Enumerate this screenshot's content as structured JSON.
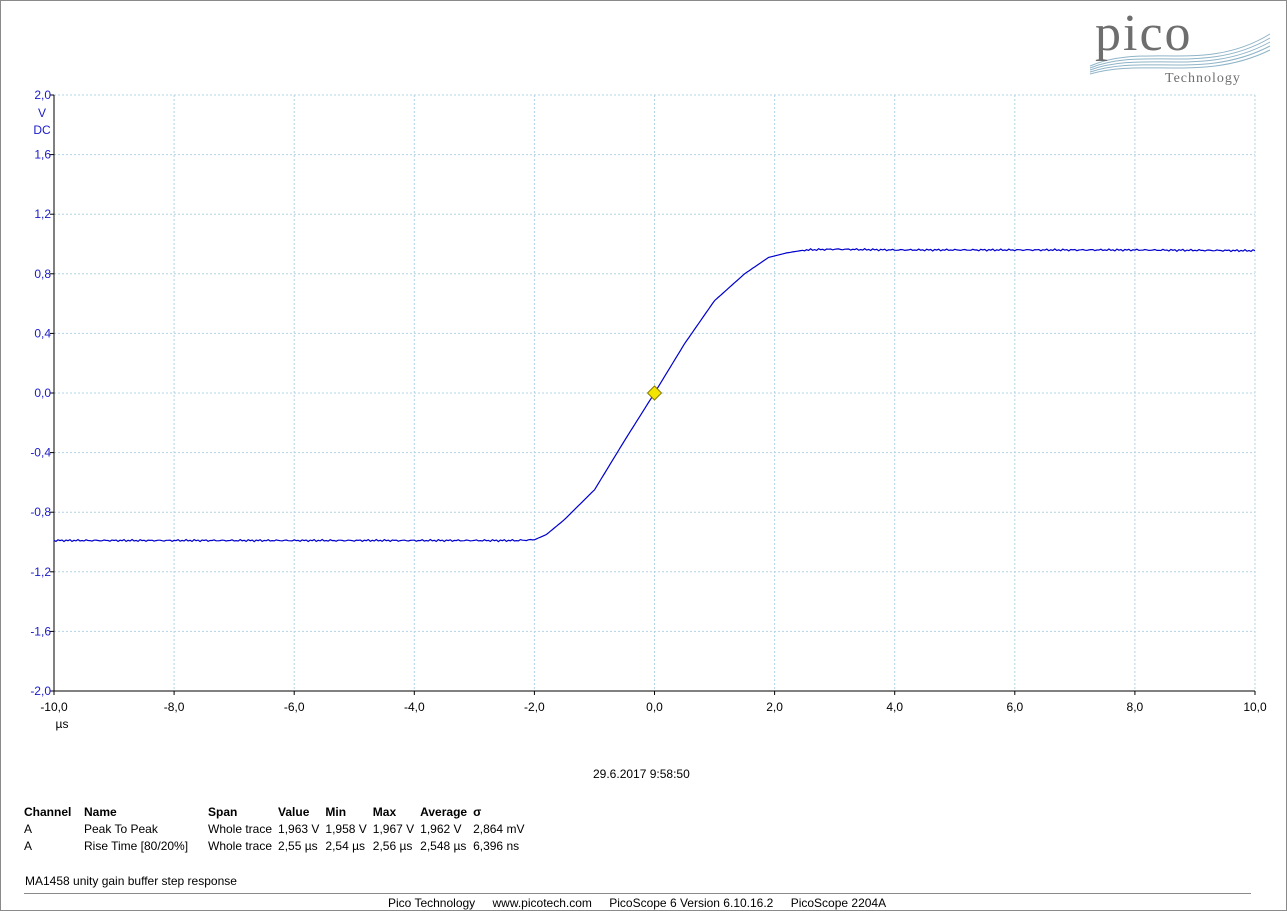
{
  "logo": {
    "name": "pico",
    "sub": "Technology"
  },
  "chart_data": {
    "type": "line",
    "title": "",
    "xlabel": "µs",
    "ylabel_lines": [
      "V",
      "DC"
    ],
    "xlim": [
      -10,
      10
    ],
    "ylim": [
      -2,
      2
    ],
    "grid": true,
    "x_ticks": [
      "-10,0",
      "-8,0",
      "-6,0",
      "-4,0",
      "-2,0",
      "0,0",
      "2,0",
      "4,0",
      "6,0",
      "8,0",
      "10,0"
    ],
    "y_ticks": [
      "2,0",
      "1,6",
      "1,2",
      "0,8",
      "0,4",
      "0,0",
      "-0,4",
      "-0,8",
      "-1,2",
      "-1,6",
      "-2,0"
    ],
    "series": [
      {
        "color": "#0000cc",
        "x": [
          -10,
          -8,
          -6,
          -4,
          -2.3,
          -2.0,
          -1.8,
          -1.5,
          -1.0,
          -0.5,
          0.0,
          0.5,
          1.0,
          1.5,
          1.9,
          2.2,
          2.5,
          3.0,
          4.0,
          6.0,
          8.0,
          10.0
        ],
        "y": [
          -0.99,
          -0.99,
          -0.99,
          -0.99,
          -0.99,
          -0.985,
          -0.95,
          -0.85,
          -0.65,
          -0.32,
          0.0,
          0.33,
          0.62,
          0.8,
          0.91,
          0.94,
          0.96,
          0.965,
          0.96,
          0.96,
          0.96,
          0.955
        ]
      }
    ],
    "trigger_marker": {
      "x": 0.0,
      "y": 0.0,
      "color": "#f2e600"
    }
  },
  "timestamp": "29.6.2017 9:58:50",
  "measurements": {
    "headers": [
      "Channel",
      "Name",
      "Span",
      "Value",
      "Min",
      "Max",
      "Average",
      "σ"
    ],
    "rows": [
      [
        "A",
        "Peak To Peak",
        "Whole trace",
        "1,963 V",
        "1,958 V",
        "1,967 V",
        "1,962 V",
        "2,864 mV"
      ],
      [
        "A",
        "Rise Time  [80/20%]",
        "Whole trace",
        "2,55 µs",
        "2,54 µs",
        "2,56 µs",
        "2,548 µs",
        "6,396 ns"
      ]
    ]
  },
  "note": "MA1458 unity gain buffer step response",
  "footer": [
    "Pico Technology",
    "www.picotech.com",
    "PicoScope 6 Version 6.10.16.2",
    "PicoScope 2204A"
  ]
}
